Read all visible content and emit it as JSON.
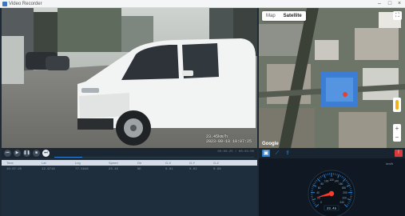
{
  "window": {
    "title": "Video Recorder",
    "min_glyph": "–",
    "max_glyph": "□",
    "close_glyph": "×"
  },
  "video": {
    "overlay_line1": "23.45km/h",
    "overlay_line2": "2023-09-18 10:07:25"
  },
  "map": {
    "tabs": [
      {
        "label": "Map",
        "active": false
      },
      {
        "label": "Satellite",
        "active": true
      }
    ],
    "fullscreen_glyph": "⛶",
    "zoom_in": "+",
    "zoom_out": "−",
    "attribution": "Google"
  },
  "controls": {
    "buttons": [
      {
        "name": "skip-back-button",
        "glyph": "⏮"
      },
      {
        "name": "play-button",
        "glyph": "▶"
      },
      {
        "name": "pause-button",
        "glyph": "❚❚"
      },
      {
        "name": "stop-button",
        "glyph": "■"
      },
      {
        "name": "skip-forward-button",
        "glyph": "⏭"
      }
    ],
    "time_current": "00:00:25",
    "time_total": "00:03:00",
    "progress": 0.14
  },
  "table": {
    "columns": [
      "Time",
      "Lat",
      "Lng",
      "Speed",
      "Dir",
      "G-X",
      "G-Y",
      "G-Z"
    ],
    "rows": [
      [
        "10:07:25",
        "12.9716",
        "77.5946",
        "23.45",
        "NE",
        "0.01",
        "0.02",
        "0.98"
      ]
    ]
  },
  "panel": {
    "tools": [
      {
        "name": "video-view-icon",
        "glyph": "▣"
      },
      {
        "name": "route-icon",
        "glyph": "⟋"
      },
      {
        "name": "export-icon",
        "glyph": "⇪"
      },
      {
        "name": "alert-icon",
        "glyph": "!"
      }
    ],
    "unit": "km/h"
  },
  "speedometer": {
    "speed_value": 23.45,
    "max": 240,
    "ticks": [
      "0",
      "20",
      "40",
      "60",
      "80",
      "100",
      "120",
      "140",
      "160",
      "180",
      "200",
      "220",
      "240"
    ],
    "readout": "23.45",
    "accent": "#ff3a2a",
    "tick_color": "#2f86d6"
  }
}
